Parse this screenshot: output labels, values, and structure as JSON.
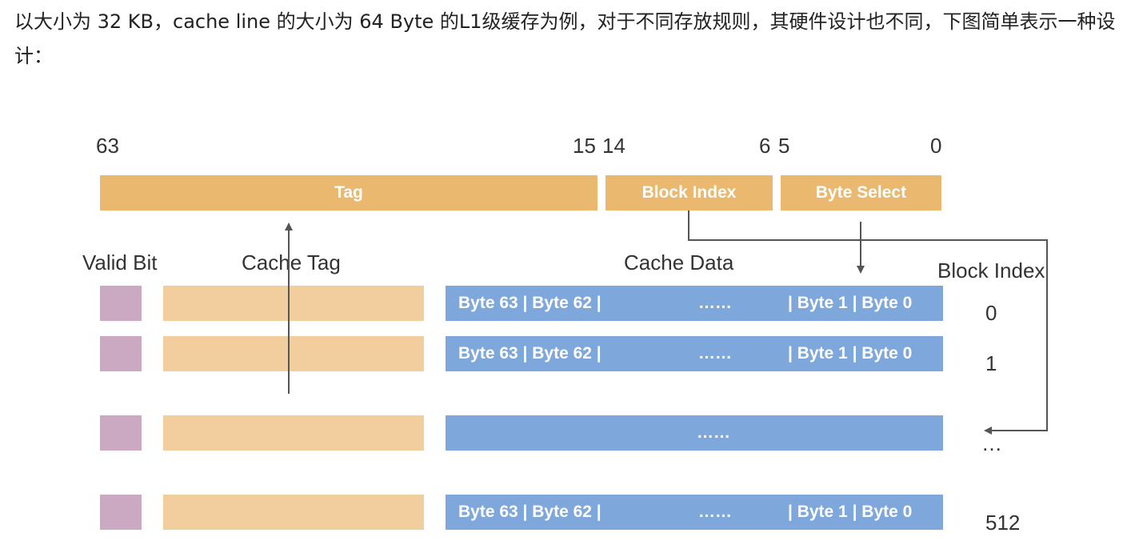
{
  "paragraph": "以大小为 32 KB，cache line 的大小为 64 Byte 的L1级缓存为例，对于不同存放规则，其硬件设计也不同，下图简单表示一种设计：",
  "diagram": {
    "bit_positions": [
      "63",
      "15",
      "14",
      "6",
      "5",
      "0"
    ],
    "fields": {
      "tag": "Tag",
      "block_index": "Block Index",
      "byte_select": "Byte Select"
    },
    "headers": {
      "valid_bit": "Valid Bit",
      "cache_tag": "Cache Tag",
      "cache_data": "Cache Data",
      "block_index": "Block Index"
    },
    "row_data": {
      "left": "Byte 63 | Byte 62 |",
      "middle": "……",
      "right": "| Byte 1 | Byte 0"
    },
    "ellipsis_row": "……",
    "row_indices": [
      "0",
      "1",
      "…",
      "512"
    ],
    "colors": {
      "field": "#eab86e",
      "tag_cell": "#f2ce9e",
      "valid_cell": "#cca9c2",
      "data_cell": "#7ea7dc",
      "arrow": "#555555"
    }
  }
}
